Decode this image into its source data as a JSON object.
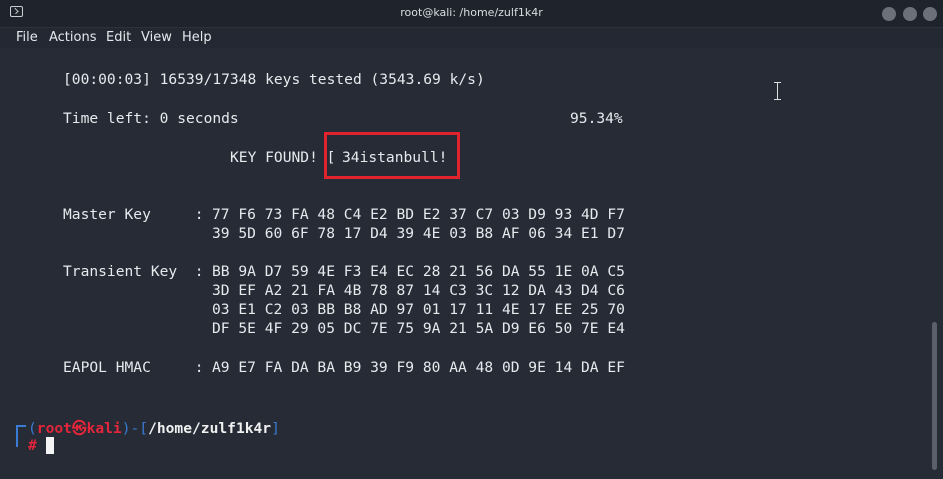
{
  "window": {
    "title": "root@kali: /home/zulf1k4r",
    "icon": "terminal-icon"
  },
  "menu": [
    "File",
    "Actions",
    "Edit",
    "View",
    "Help"
  ],
  "terminal": {
    "progress_line": "[00:00:03] 16539/17348 keys tested (3543.69 k/s)",
    "time_left": "Time left: 0 seconds",
    "percent": "95.34%",
    "key_found_label": "KEY FOUND! [",
    "key_value": "34istanbull!",
    "master_key_label": "Master Key     :",
    "master_key_lines": [
      "77 F6 73 FA 48 C4 E2 BD E2 37 C7 03 D9 93 4D F7",
      "39 5D 60 6F 78 17 D4 39 4E 03 B8 AF 06 34 E1 D7"
    ],
    "transient_key_label": "Transient Key  :",
    "transient_key_lines": [
      "BB 9A D7 59 4E F3 E4 EC 28 21 56 DA 55 1E 0A C5",
      "3D EF A2 21 FA 4B 78 87 14 C3 3C 12 DA 43 D4 C6",
      "03 E1 C2 03 BB B8 AD 97 01 17 11 4E 17 EE 25 70",
      "DF 5E 4F 29 05 DC 7E 75 9A 21 5A D9 E6 50 7E E4"
    ],
    "eapol_label": "EAPOL HMAC     :",
    "eapol_line": "A9 E7 FA DA BA B9 39 F9 80 AA 48 0D 9E 14 DA EF"
  },
  "prompt": {
    "open": "(",
    "user": "root",
    "at": "㉿",
    "host": "kali",
    "close_sep": ")-[",
    "path": "/home/zulf1k4r",
    "end": "]",
    "hash": "#"
  },
  "colors": {
    "background": "#262b36",
    "text": "#e7e9ed",
    "highlight_box": "#e0232d",
    "prompt_red": "#e3263a",
    "prompt_blue": "#3a7bd5"
  }
}
